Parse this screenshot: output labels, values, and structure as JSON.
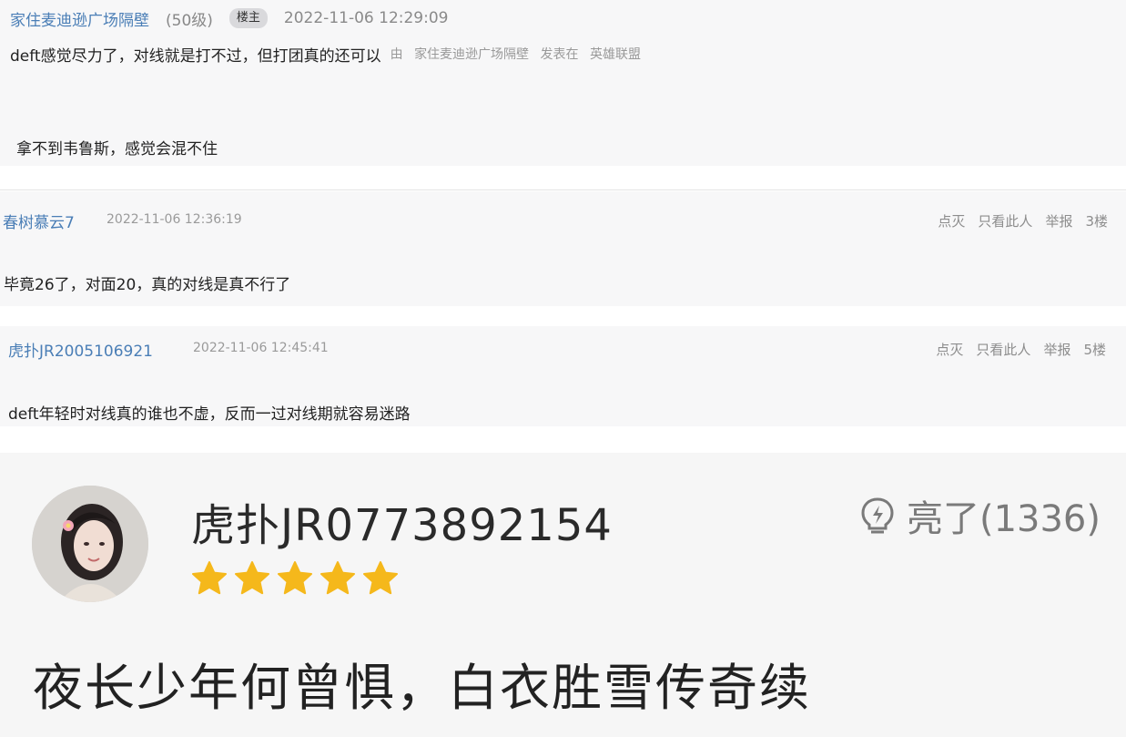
{
  "quote": {
    "username": "家住麦迪逊广场隔壁",
    "level": "(50级)",
    "badge": "楼主",
    "time": "2022-11-06 12:29:09",
    "title": "deft感觉尽力了，对线就是打不过，但打团真的还可以",
    "meta_by": "由",
    "meta_author": "家住麦迪逊广场隔壁",
    "meta_posted": "发表在",
    "meta_forum": "英雄联盟",
    "body": "拿不到韦鲁斯，感觉会混不住"
  },
  "replies": [
    {
      "username": "春树慕云7",
      "time": "2022-11-06 12:36:19",
      "text": "毕竟26了，对面20，真的对线是真不行了",
      "floor": "3楼"
    },
    {
      "username": "虎扑JR2005106921",
      "time": "2022-11-06 12:45:41",
      "text": "deft年轻时对线真的谁也不虚，反而一过对线期就容易迷路",
      "floor": "5楼"
    }
  ],
  "actions": {
    "dislike": "点灭",
    "only_this": "只看此人",
    "report": "举报"
  },
  "card": {
    "username": "虎扑JR0773892154",
    "stars": 5,
    "star_color": "#f5b81b",
    "like_label": "亮了(1336)",
    "like_icon": "lightbulb-icon",
    "text": "夜长少年何曾惧，白衣胜雪传奇续"
  }
}
